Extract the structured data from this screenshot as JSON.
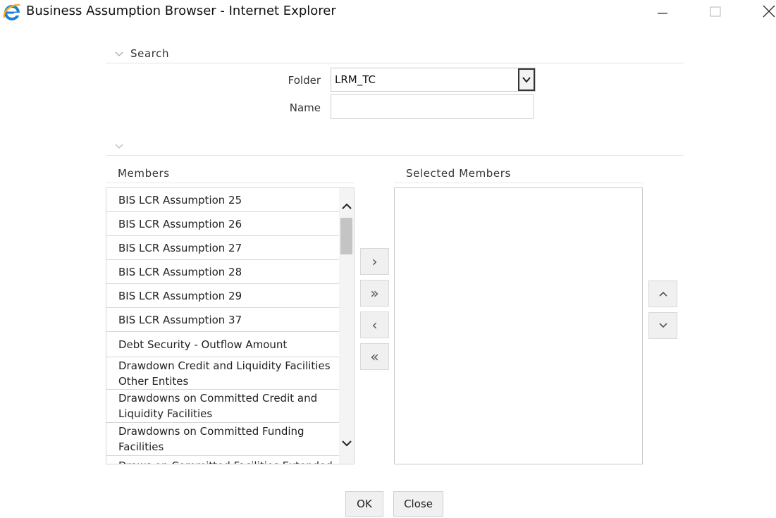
{
  "window": {
    "title": "Business Assumption Browser - Internet Explorer",
    "icon": "internet-explorer-icon",
    "controls": [
      "minimize-icon",
      "maximize-icon",
      "close-icon"
    ]
  },
  "search": {
    "label": "Search",
    "folder_label": "Folder",
    "folder_value": "LRM_TC",
    "name_label": "Name",
    "name_value": ""
  },
  "members": {
    "label": "Members",
    "items": [
      "BIS LCR Assumption 25",
      "BIS LCR Assumption 26",
      "BIS LCR Assumption 27",
      "BIS LCR Assumption 28",
      "BIS LCR Assumption 29",
      "BIS LCR Assumption 37",
      "Debt Security - Outflow Amount",
      "Drawdown Credit and Liquidity Facilities Other Entites",
      "Drawdowns on Committed Credit and Liquidity Facilities",
      "Drawdowns on Committed Funding Facilities",
      "Draws on Committed Facilities Extended"
    ]
  },
  "selected_members": {
    "label": "Selected Members",
    "items": []
  },
  "transfer_buttons": {
    "move_right": "›",
    "move_all_right": "»",
    "move_left": "‹",
    "move_all_left": "«"
  },
  "footer": {
    "ok_label": "OK",
    "close_label": "Close"
  }
}
